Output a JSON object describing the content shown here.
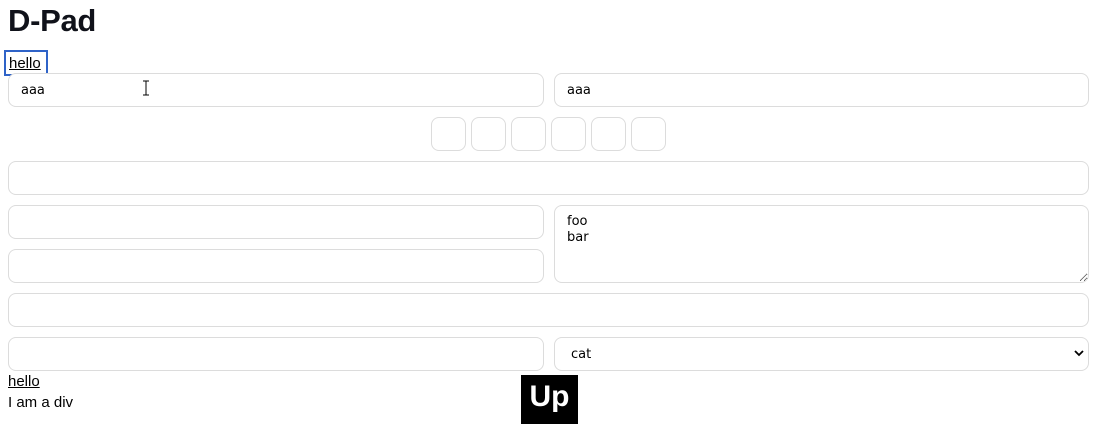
{
  "page": {
    "title": "D-Pad"
  },
  "links": {
    "top_link": "hello",
    "bottom_link": "hello"
  },
  "inputs": {
    "row1_left_value": "aaa",
    "row1_right_value": "aaa",
    "wide_1_value": "",
    "row3_left_top_value": "",
    "row3_left_bottom_value": "",
    "wide_2_value": "",
    "row5_left_value": ""
  },
  "textarea": {
    "value": "foo\nbar"
  },
  "select": {
    "selected": "cat"
  },
  "otp": {
    "cells": [
      "",
      "",
      "",
      "",
      "",
      ""
    ]
  },
  "static": {
    "div_text": "I am a div"
  },
  "buttons": {
    "up_label": "Up"
  },
  "icons": {
    "cursor": "text-cursor-icon",
    "chevron": "chevron-down-icon"
  }
}
